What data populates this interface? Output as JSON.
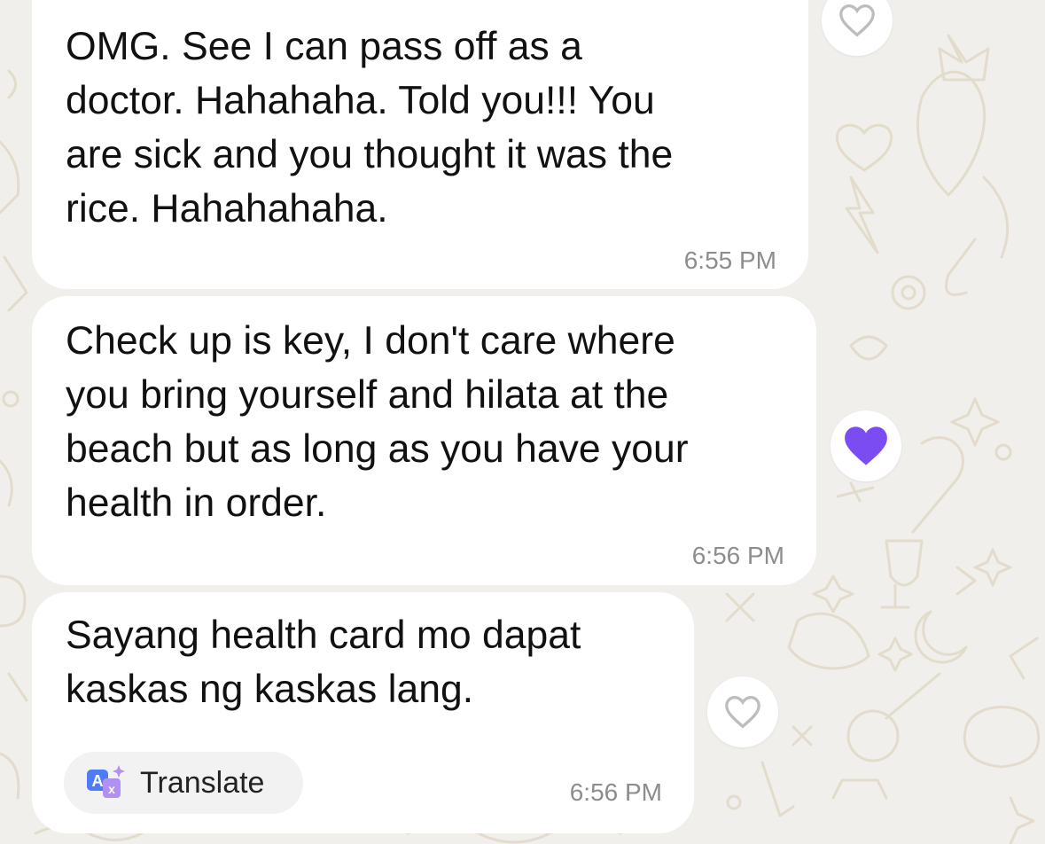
{
  "colors": {
    "background": "#f1efec",
    "bubble": "#ffffff",
    "text": "#111111",
    "timestamp": "#8d8d8d",
    "reaction_filled": "#7a4cf2",
    "reaction_outline": "#bdbdbd",
    "wallpaper_doodle": "#e3dccd"
  },
  "messages": [
    {
      "text": "OMG. See I can pass off as a\ndoctor. Hahahaha. Told you!!! You\nare sick and you thought it was the\nrice. Hahahahaha.",
      "time": "6:55 PM",
      "reaction": "heart-outline-icon"
    },
    {
      "text": "Check up is key, I don't care where\nyou bring yourself and hilata at the\nbeach but as long as you have your\nhealth in order.",
      "time": "6:56 PM",
      "reaction": "heart-filled-icon"
    },
    {
      "text": "Sayang health card mo dapat\nkaskas ng kaskas lang.",
      "time": "6:56 PM",
      "reaction": "heart-outline-icon",
      "translate_label": "Translate",
      "translate_icon": "translate-icon"
    }
  ]
}
